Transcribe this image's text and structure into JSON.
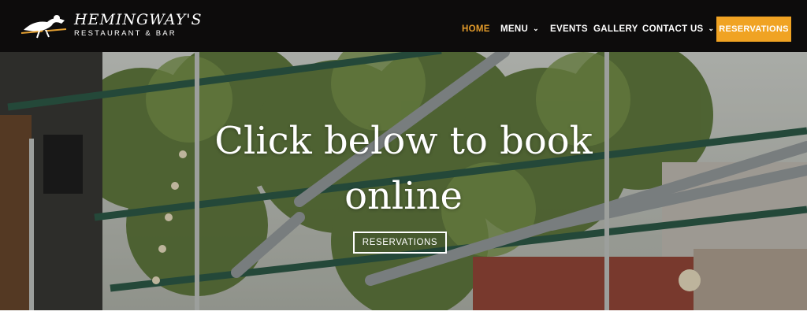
{
  "brand": {
    "name": "HEMINGWAY'S",
    "subtitle": "RESTAURANT & BAR"
  },
  "nav": {
    "items": [
      {
        "label": "HOME",
        "active": true
      },
      {
        "label": "MENU",
        "dropdown": true
      },
      {
        "label": "EVENTS"
      },
      {
        "label": "GALLERY"
      },
      {
        "label": "CONTACT US",
        "dropdown": true
      }
    ],
    "cta_label": "RESERVATIONS",
    "active_color": "#e39b2a",
    "cta_color": "#f0a323"
  },
  "hero": {
    "title_line1": "Click below to book",
    "title_line2": "online",
    "button_label": "RESERVATIONS"
  },
  "icons": {
    "dropdown": "chevron-down-icon",
    "logo": "rider-logo-icon"
  }
}
